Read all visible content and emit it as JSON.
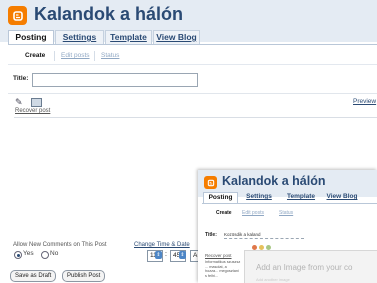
{
  "app": {
    "blog_title": "Kalandok a hálón",
    "logo_letter": "B",
    "brand_color": "#f57d00",
    "accent_color": "#2a4a74"
  },
  "tabs": [
    "Posting",
    "Settings",
    "Template",
    "View Blog"
  ],
  "subtabs": [
    "Create",
    "Edit posts",
    "Status"
  ],
  "post_form": {
    "title_label": "Title:",
    "title_value": "",
    "toolbar_icons": [
      "compose-icon",
      "image-icon"
    ],
    "recover_link": "Recover post",
    "preview_link": "Preview"
  },
  "options": {
    "allow_comments_label": "Allow New Comments on This Post",
    "yes_label": "Yes",
    "no_label": "No",
    "change_time_label": "Change Time & Date",
    "hour": "11",
    "minute": "45",
    "ampm_partial": "A"
  },
  "buttons": {
    "save_draft": "Save as Draft",
    "publish": "Publish Post"
  },
  "overlay": {
    "blog_title": "Kalandok a hálón",
    "tabs": [
      "Posting",
      "Settings",
      "Template",
      "View Blog"
    ],
    "subtabs": [
      "Create",
      "Edit posts",
      "Status"
    ],
    "title_label": "Title:",
    "title_value": "Kozösdik a kaland",
    "recover_link": "Recover post",
    "body_text": "Informatikus szuszsz ... masolat, a hozza... megosztani s felhi...",
    "dialog_title": "Add an Image from your co",
    "dialog_subtitle": "Add another image"
  }
}
